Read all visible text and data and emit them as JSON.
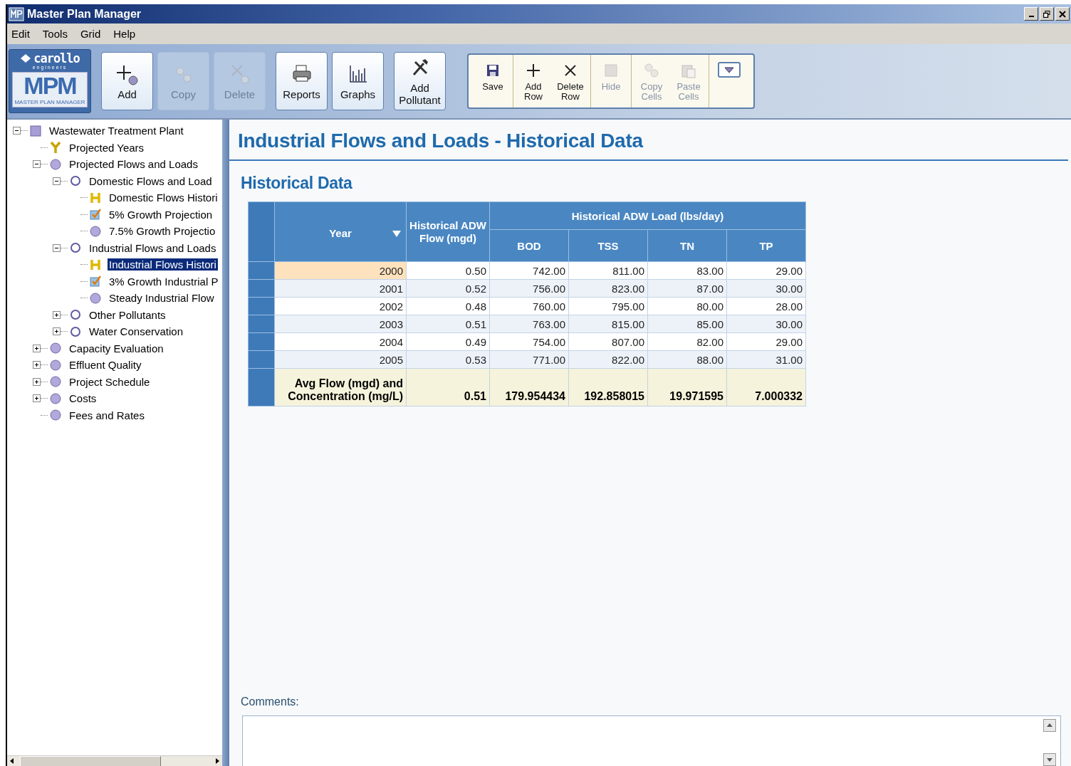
{
  "window": {
    "title": "Master Plan Manager"
  },
  "menu": [
    "Edit",
    "Tools",
    "Grid",
    "Help"
  ],
  "logo": {
    "brand": "carollo",
    "tagline": "engineers",
    "product": "MPM",
    "product_name": "MASTER PLAN MANAGER"
  },
  "toolbar": [
    {
      "kind": "large",
      "items": [
        {
          "label": "Add",
          "kind": "add",
          "disabled": false
        },
        {
          "label": "Copy",
          "kind": "copy",
          "disabled": true
        },
        {
          "label": "Delete",
          "kind": "delete",
          "disabled": true
        }
      ]
    },
    {
      "kind": "large",
      "items": [
        {
          "label": "Reports",
          "kind": "printer",
          "disabled": false
        },
        {
          "label": "Graphs",
          "kind": "chart",
          "disabled": false
        }
      ]
    },
    {
      "kind": "large",
      "items": [
        {
          "label": "Add Pollutant",
          "kind": "tools",
          "disabled": false
        }
      ]
    },
    {
      "kind": "panel",
      "sections": [
        [
          {
            "label": "Save",
            "kind": "save",
            "disabled": false
          }
        ],
        [
          {
            "label": "Add Row",
            "kind": "plus",
            "disabled": false
          },
          {
            "label": "Delete Row",
            "kind": "cross",
            "disabled": false
          }
        ],
        [
          {
            "label": "Hide",
            "kind": "square",
            "disabled": true
          }
        ],
        [
          {
            "label": "Copy Cells",
            "kind": "copy",
            "disabled": true
          },
          {
            "label": "Paste Cells",
            "kind": "paste",
            "disabled": true
          }
        ],
        [
          {
            "kind": "dropdown",
            "disabled": false
          }
        ]
      ]
    }
  ],
  "tree": {
    "label": "Wastewater Treatment Plant",
    "kind": "plant",
    "expanded": true,
    "selected": false,
    "children": [
      {
        "label": "Projected Years",
        "kind": "years",
        "selected": false
      },
      {
        "label": "Projected Flows and Loads",
        "kind": "ball",
        "expanded": true,
        "selected": false,
        "children": [
          {
            "label": "Domestic Flows and Load",
            "kind": "ring",
            "expanded": true,
            "selected": false,
            "children": [
              {
                "label": "Domestic Flows Histori",
                "kind": "history",
                "selected": false
              },
              {
                "label": "5% Growth Projection",
                "kind": "check",
                "selected": false
              },
              {
                "label": "7.5% Growth Projectio",
                "kind": "ball",
                "selected": false
              }
            ]
          },
          {
            "label": "Industrial Flows and Loads",
            "kind": "ring",
            "expanded": true,
            "selected": false,
            "children": [
              {
                "label": "Industrial Flows Histori",
                "kind": "history",
                "selected": true
              },
              {
                "label": "3% Growth Industrial P",
                "kind": "check",
                "selected": false
              },
              {
                "label": "Steady Industrial Flow",
                "kind": "ball",
                "selected": false
              }
            ]
          },
          {
            "label": "Other Pollutants",
            "kind": "ring",
            "expanded": false,
            "selected": false
          },
          {
            "label": "Water Conservation",
            "kind": "ring",
            "expanded": false,
            "selected": false
          }
        ]
      },
      {
        "label": "Capacity Evaluation",
        "kind": "ball",
        "expanded": false,
        "selected": false
      },
      {
        "label": "Effluent Quality",
        "kind": "ball",
        "expanded": false,
        "selected": false
      },
      {
        "label": "Project Schedule",
        "kind": "ball",
        "expanded": false,
        "selected": false
      },
      {
        "label": "Costs",
        "kind": "ball",
        "expanded": false,
        "selected": false
      },
      {
        "label": "Fees and Rates",
        "kind": "ball",
        "selected": false
      }
    ]
  },
  "page": {
    "title": "Industrial Flows and Loads - Historical Data",
    "section": "Historical Data",
    "comments_label": "Comments:"
  },
  "grid": {
    "year_column": {
      "label": "Year",
      "sorted": true
    },
    "flow_column": {
      "label": "Historical ADW Flow (mgd)"
    },
    "group": {
      "label": "Historical ADW Load (lbs/day)",
      "columns": [
        "BOD",
        "TSS",
        "TN",
        "TP"
      ]
    },
    "rows": [
      {
        "selected": true,
        "cells": [
          "2000",
          "0.50",
          "742.00",
          "811.00",
          "83.00",
          "29.00"
        ]
      },
      {
        "selected": false,
        "cells": [
          "2001",
          "0.52",
          "756.00",
          "823.00",
          "87.00",
          "30.00"
        ]
      },
      {
        "selected": false,
        "cells": [
          "2002",
          "0.48",
          "760.00",
          "795.00",
          "80.00",
          "28.00"
        ]
      },
      {
        "selected": false,
        "cells": [
          "2003",
          "0.51",
          "763.00",
          "815.00",
          "85.00",
          "30.00"
        ]
      },
      {
        "selected": false,
        "cells": [
          "2004",
          "0.49",
          "754.00",
          "807.00",
          "82.00",
          "29.00"
        ]
      },
      {
        "selected": false,
        "cells": [
          "2005",
          "0.53",
          "771.00",
          "822.00",
          "88.00",
          "31.00"
        ]
      }
    ],
    "footer": {
      "label_lines": [
        "Avg Flow (mgd) and",
        "Concentration (mg/L)"
      ],
      "values": [
        "0.51",
        "179.954434",
        "192.858015",
        "19.971595",
        "7.000332"
      ]
    }
  }
}
